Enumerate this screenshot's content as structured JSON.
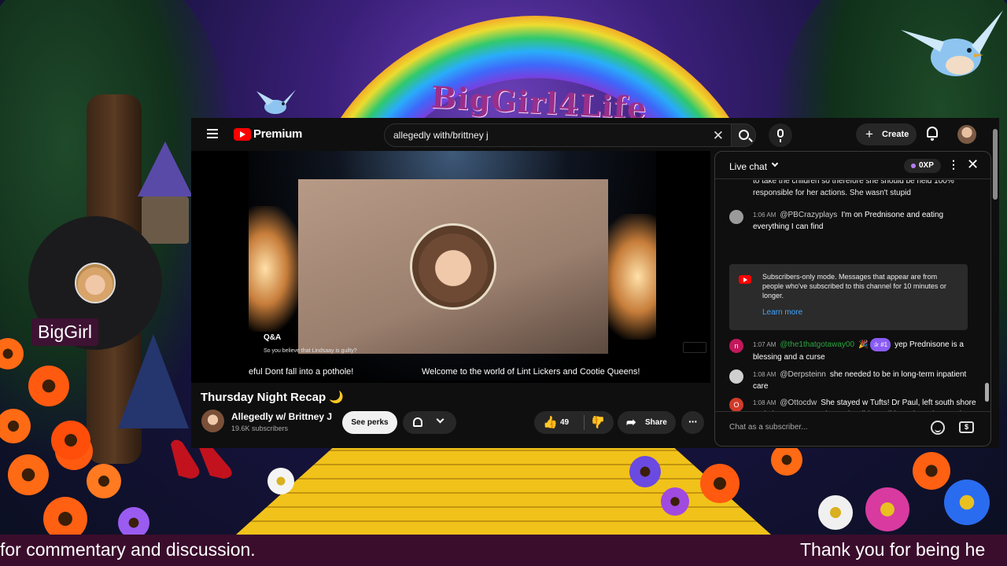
{
  "overlay": {
    "brand_text": "BigGirl4Life",
    "webcam_name": "BigGirl",
    "ticker_left": "for commentary and discussion.",
    "ticker_right": "Thank you for being he"
  },
  "youtube": {
    "brand": "Premium",
    "search": {
      "value": "allegedly with/brittney j",
      "clear_icon": "close-icon"
    },
    "create_label": "Create",
    "video": {
      "qa_title": "Q&A",
      "qa_text": "So you believe that Lindsaay is guilty?",
      "crawl_left": "eful Dont fall into a pothole!",
      "crawl_right": "Welcome to the world of Lint Lickers and Cootie Queens!"
    },
    "title": "Thursday Night Recap 🌙",
    "channel": {
      "name": "Allegedly w/ Brittney J",
      "subscribers": "19.6K subscribers"
    },
    "perks_label": "See perks",
    "likes": "49",
    "share_label": "Share"
  },
  "chat": {
    "title": "Live chat",
    "xp": "0XP",
    "messages": [
      {
        "text": "to take the children so therefore she should be held 100% responsible for her actions. She wasn't stupid"
      },
      {
        "time": "1:06 AM",
        "author": "@PBCrazyplays",
        "text": "I'm on Prednisone and eating everything I can find"
      },
      {
        "time": "1:07 AM",
        "author": "@the1thatgotaway00",
        "badge": "🎉",
        "rank": "✰ #1",
        "text": "yep Prednisone is a blessing and a curse",
        "avatar": "n"
      },
      {
        "time": "1:08 AM",
        "author": "@Derpsteinn",
        "text": "she needed to be in long-term inpatient care"
      },
      {
        "time": "1:08 AM",
        "author": "@Ottocdw",
        "text": "She stayed w Tufts! Dr Paul, left south shore and she got put w Jolatta who didn't call her when she was in crisis ! She was let down by the providers! It's a definite malpractice",
        "avatar": "O"
      }
    ],
    "notice": {
      "text": "Subscribers-only mode. Messages that appear are from people who've subscribed to this channel for 10 minutes or longer.",
      "link": "Learn more"
    },
    "input_placeholder": "Chat as a subscriber...",
    "money_icon": "$"
  },
  "colors": {
    "accent_red": "#ff0000",
    "link_blue": "#3ea6ff",
    "author_green": "#2ba640",
    "ticker_bg": "#3a0d2c"
  }
}
